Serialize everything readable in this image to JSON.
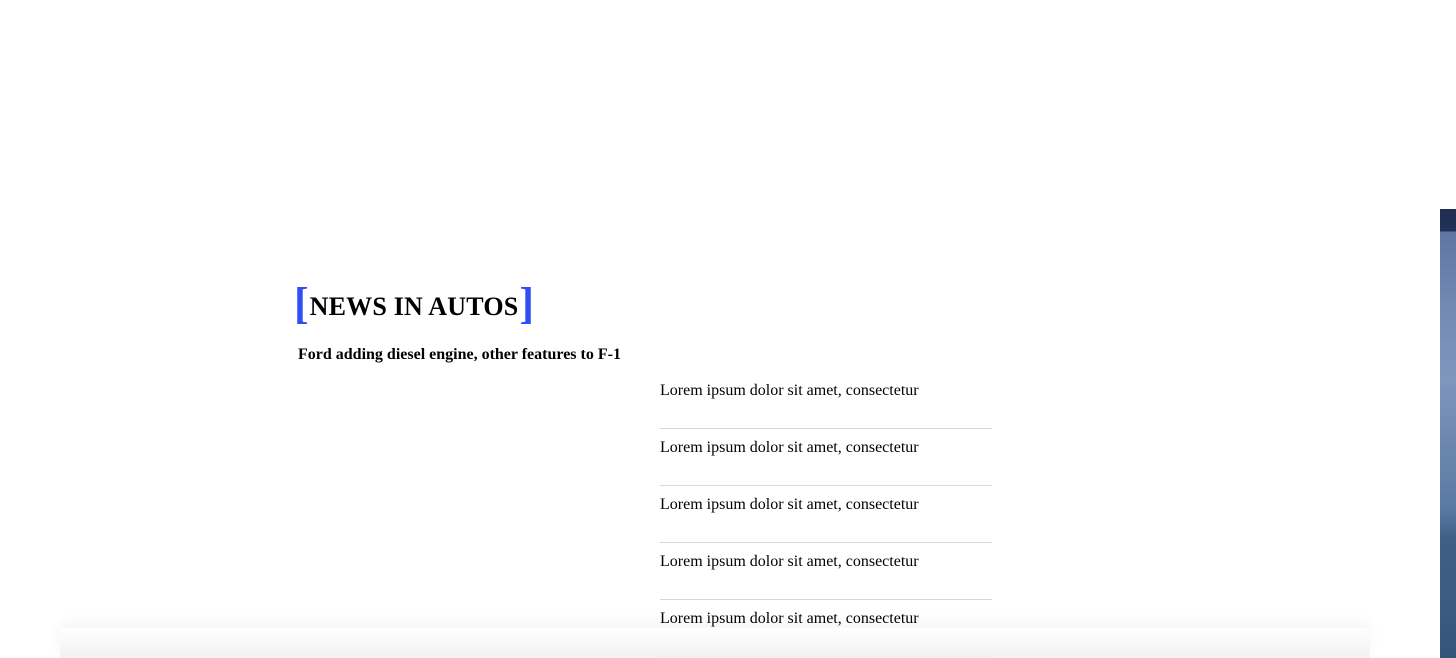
{
  "section": {
    "title": "NEWS IN AUTOS",
    "bracket_open": "[",
    "bracket_close": "]",
    "accent_color": "#2f4ff5"
  },
  "lead_story": {
    "headline": "Ford adding diesel engine, other features to F-1"
  },
  "stories": [
    {
      "title": "Lorem ipsum dolor sit amet, consectetur"
    },
    {
      "title": "Lorem ipsum dolor sit amet, consectetur"
    },
    {
      "title": "Lorem ipsum dolor sit amet, consectetur"
    },
    {
      "title": "Lorem ipsum dolor sit amet, consectetur"
    },
    {
      "title": "Lorem ipsum dolor sit amet, consectetur"
    }
  ]
}
